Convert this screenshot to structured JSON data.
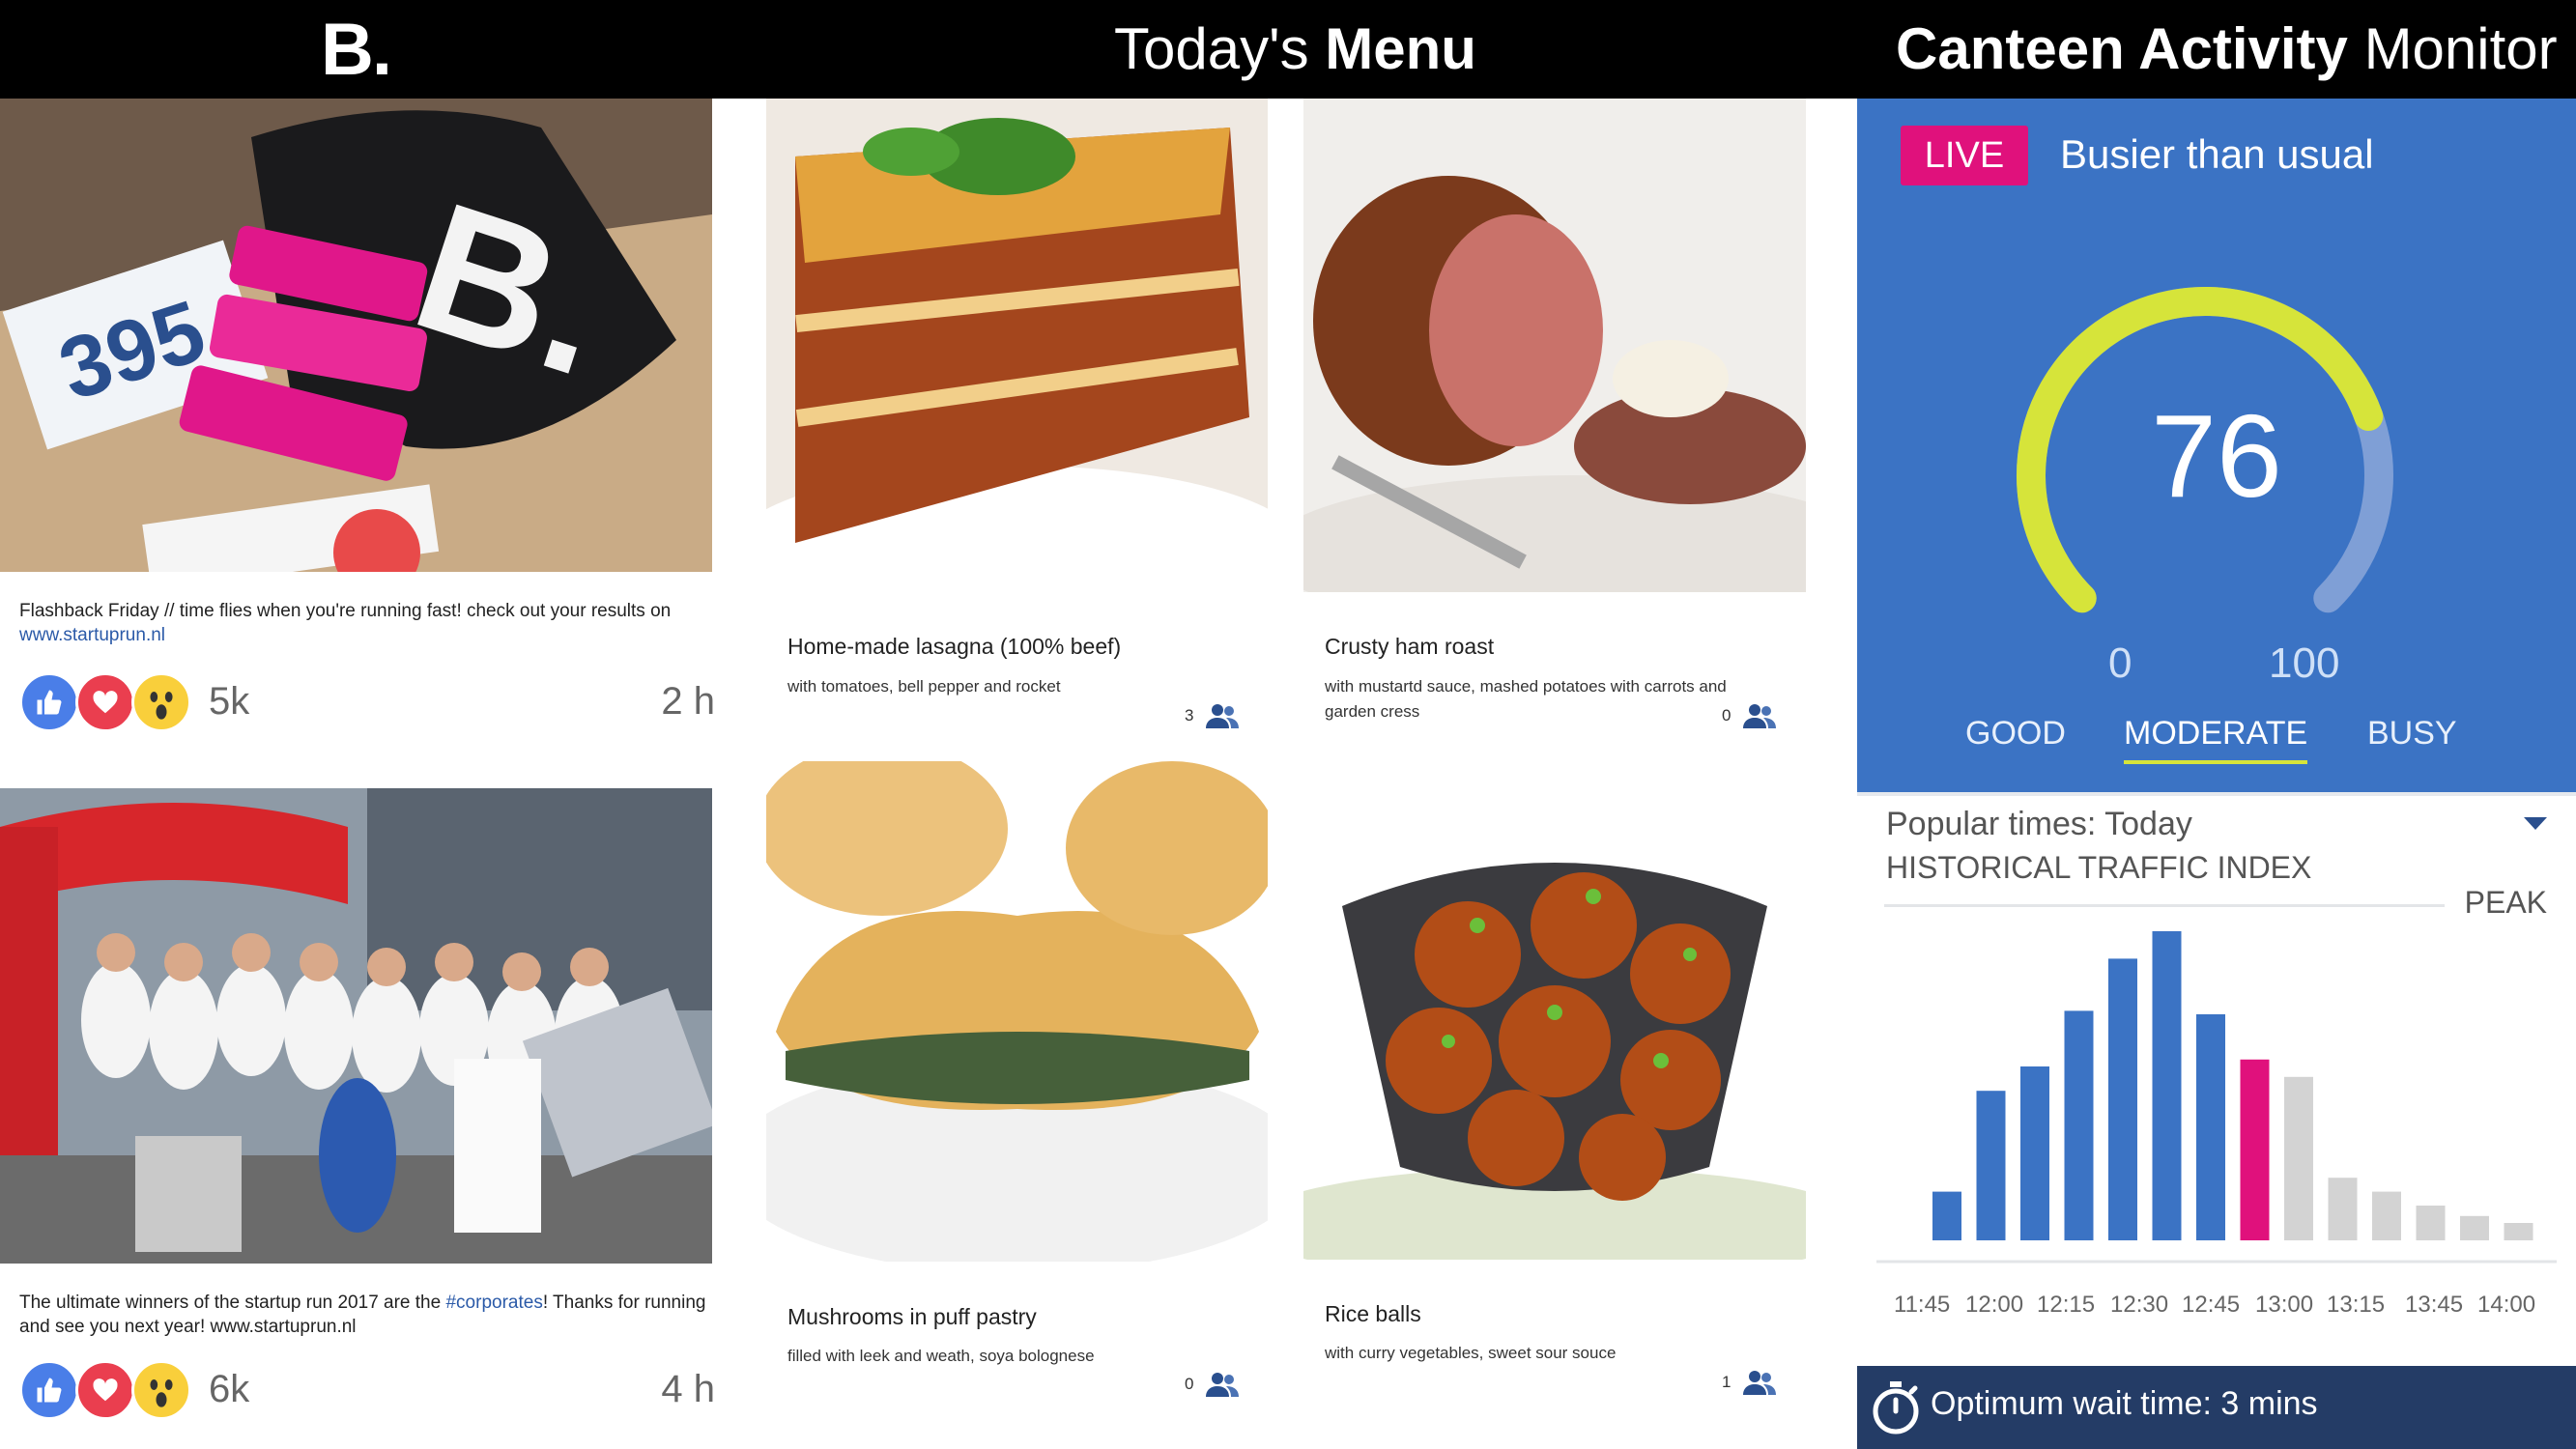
{
  "header": {
    "logo": "B.",
    "menu_title_light": "Today's",
    "menu_title_bold": "Menu",
    "monitor_title_bold": "Canteen Activity",
    "monitor_title_light": "Monitor"
  },
  "feed": {
    "posts": [
      {
        "caption": "Flashback Friday // time flies when you're running fast! check out your results on ",
        "link": "www.startuprun.nl",
        "reaction_count": "5k",
        "time": "2 h"
      },
      {
        "caption_pre": "The ultimate winners of the startup run 2017 are the ",
        "hashtag": "#corporates",
        "caption_post": "! Thanks for running and see you next year!  www.startuprun.nl",
        "reaction_count": "6k",
        "time": "4 h"
      }
    ]
  },
  "menu": {
    "dishes": [
      {
        "name": "Home-made lasagna (100% beef)",
        "description": "with tomatoes, bell pepper and rocket",
        "count": "3"
      },
      {
        "name": "Crusty ham roast",
        "description": "with mustartd sauce, mashed potatoes with carrots and garden cress",
        "count": "0"
      },
      {
        "name": "Mushrooms in puff pastry",
        "description": "filled with leek and weath, soya bolognese",
        "count": "0"
      },
      {
        "name": "Rice balls",
        "description": "with curry vegetables, sweet sour souce",
        "count": "1"
      }
    ]
  },
  "monitor": {
    "live_label": "LIVE",
    "status": "Busier than usual",
    "gauge": {
      "value": 76,
      "value_text": "76",
      "min": "0",
      "max": "100"
    },
    "levels": [
      "GOOD",
      "MODERATE",
      "BUSY"
    ],
    "selected_level": "MODERATE",
    "colors": {
      "panel": "#3b73c4",
      "gauge": "#d6e43a",
      "live": "#e0117c",
      "current_bar": "#e0117c",
      "past_bar": "#3b73c4",
      "future_bar": "#d3d3d3"
    },
    "popular_times": "Popular times: Today",
    "historical_label": "HISTORICAL TRAFFIC INDEX",
    "peak_label": "PEAK",
    "wait_time": "Optimum wait time: 3 mins"
  },
  "chart_data": {
    "type": "bar",
    "title": "",
    "xlabel": "",
    "ylabel": "",
    "tick_labels": [
      "11:45",
      "12:00",
      "12:15",
      "12:30",
      "12:45",
      "13:00",
      "13:15",
      "13:45",
      "14:00"
    ],
    "values": [
      14,
      43,
      50,
      66,
      81,
      94,
      65,
      52,
      47,
      18,
      14,
      10,
      7,
      5
    ],
    "status": [
      "past",
      "past",
      "past",
      "past",
      "past",
      "past",
      "past",
      "current",
      "future",
      "future",
      "future",
      "future",
      "future",
      "future"
    ],
    "ylim": [
      0,
      100
    ],
    "grid": false
  }
}
